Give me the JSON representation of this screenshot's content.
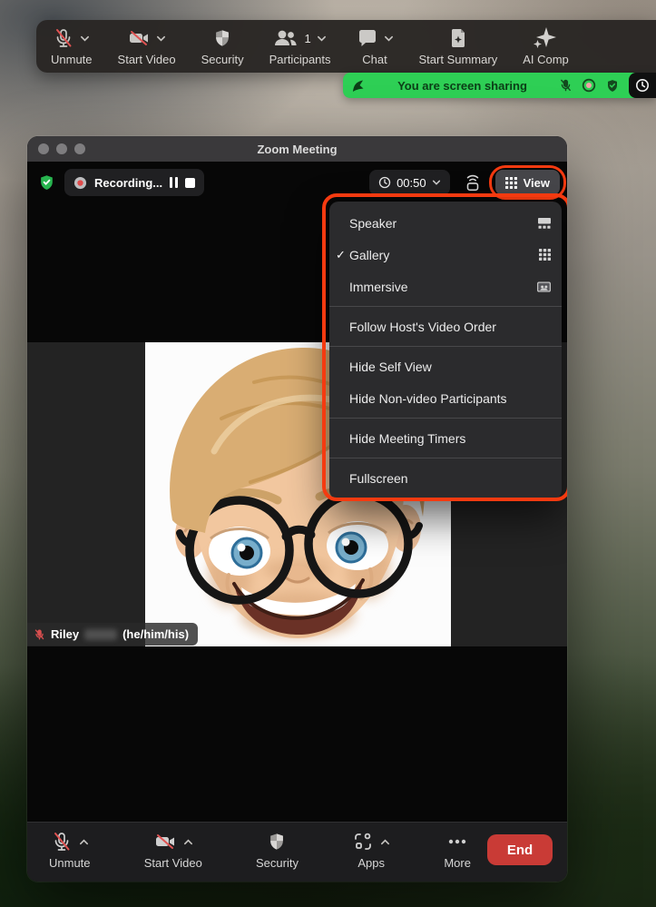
{
  "share_banner": {
    "text": "You are screen sharing"
  },
  "top_toolbar": {
    "items": [
      {
        "label": "Unmute"
      },
      {
        "label": "Start Video"
      },
      {
        "label": "Security"
      },
      {
        "label": "Participants",
        "badge": "1"
      },
      {
        "label": "Chat"
      },
      {
        "label": "Start Summary"
      },
      {
        "label": "AI Comp"
      }
    ]
  },
  "window": {
    "title": "Zoom Meeting",
    "recording_label": "Recording...",
    "timer": "00:50",
    "view_label": "View",
    "menu": {
      "items": [
        {
          "label": "Speaker"
        },
        {
          "label": "Gallery",
          "checked": true
        },
        {
          "label": "Immersive"
        },
        {
          "label": "Follow Host's Video Order"
        },
        {
          "label": "Hide Self View"
        },
        {
          "label": "Hide Non-video Participants"
        },
        {
          "label": "Hide Meeting Timers"
        },
        {
          "label": "Fullscreen"
        }
      ]
    },
    "nametag": {
      "name": "Riley",
      "pronouns": "(he/him/his)"
    },
    "bottom_toolbar": {
      "items": [
        {
          "label": "Unmute"
        },
        {
          "label": "Start Video"
        },
        {
          "label": "Security"
        },
        {
          "label": "Apps"
        },
        {
          "label": "More"
        }
      ],
      "end_label": "End"
    }
  },
  "icons": {
    "check": "✓"
  },
  "colors": {
    "banner_green": "#2ecf55",
    "annotation_red": "#f53a10",
    "end_red": "#c93b36",
    "record_red": "#e04b4b"
  }
}
